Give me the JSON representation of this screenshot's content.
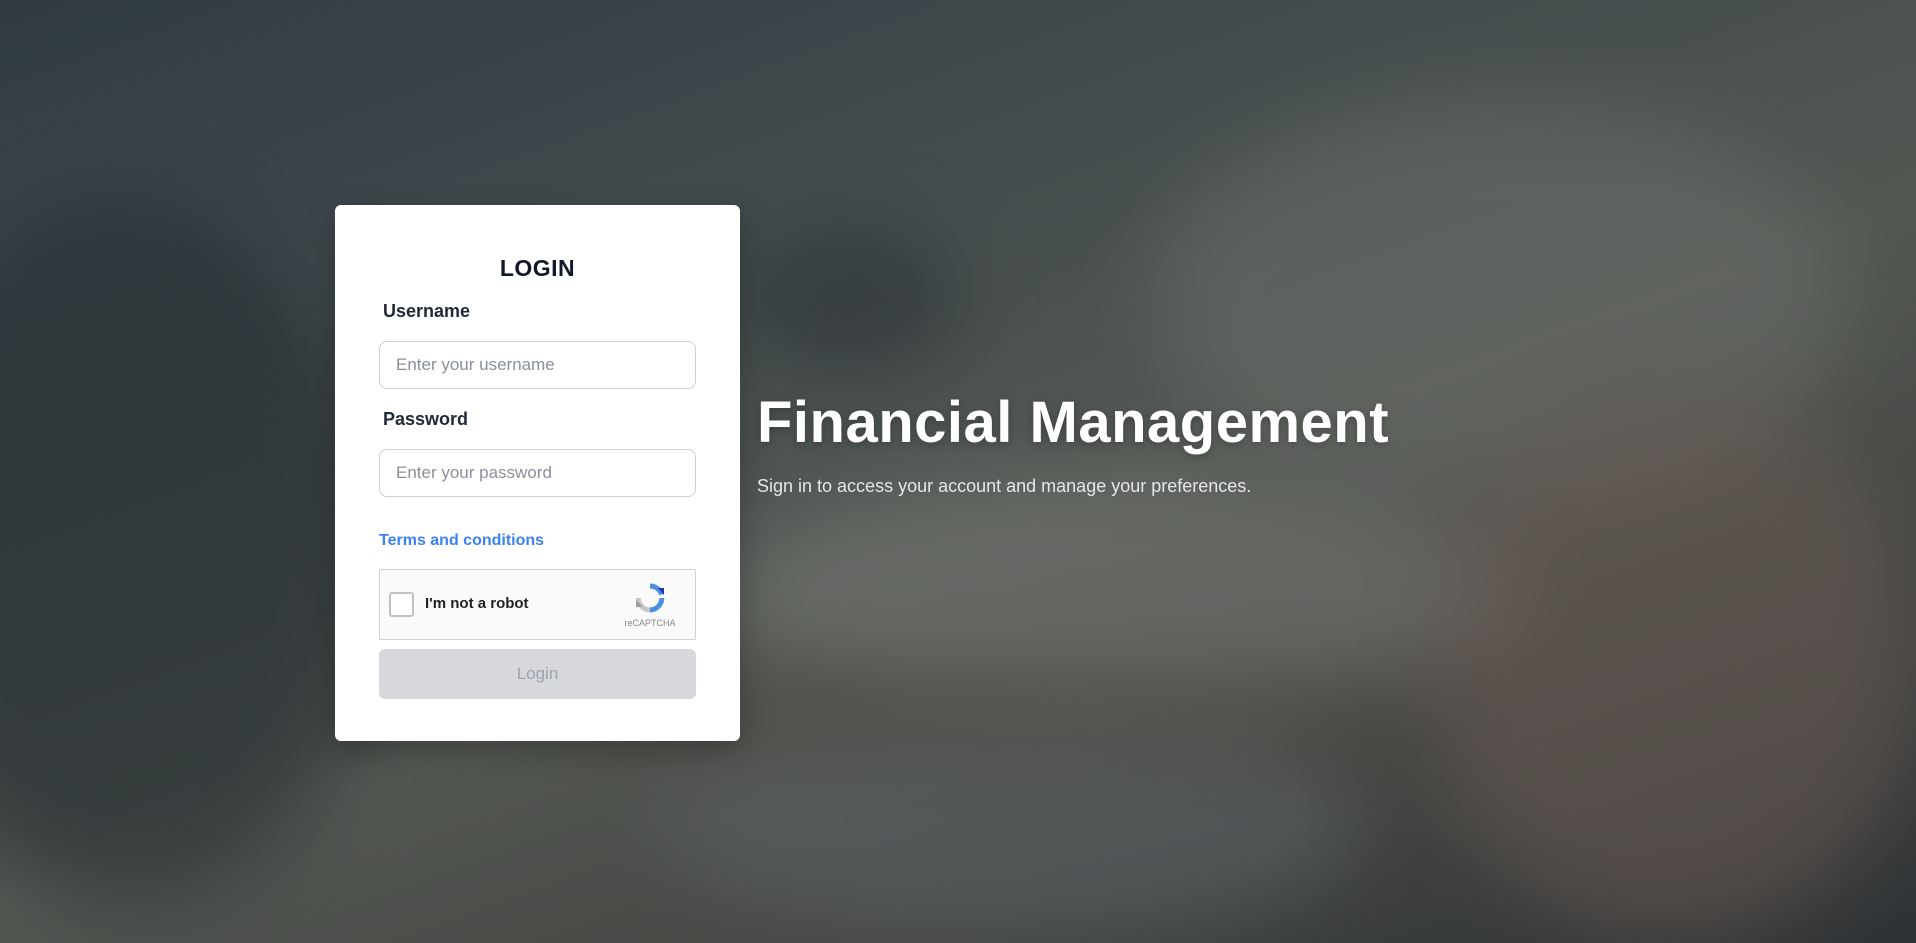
{
  "hero": {
    "title": "Financial Management",
    "subtitle": "Sign in to access your account and manage your preferences."
  },
  "login_card": {
    "title": "LOGIN",
    "username": {
      "label": "Username",
      "value": "",
      "placeholder": "Enter your username"
    },
    "password": {
      "label": "Password",
      "value": "",
      "placeholder": "Enter your password"
    },
    "terms_link": "Terms and conditions",
    "recaptcha": {
      "label": "I'm not a robot",
      "brand": "reCAPTCHA",
      "checked": false,
      "icon": "recaptcha-logo-icon"
    },
    "login_button": "Login",
    "login_button_disabled": true
  },
  "colors": {
    "link": "#3b82f6",
    "button_disabled_bg": "#d6d8dc",
    "button_disabled_text": "#9ca3af",
    "card_bg": "#ffffff"
  }
}
